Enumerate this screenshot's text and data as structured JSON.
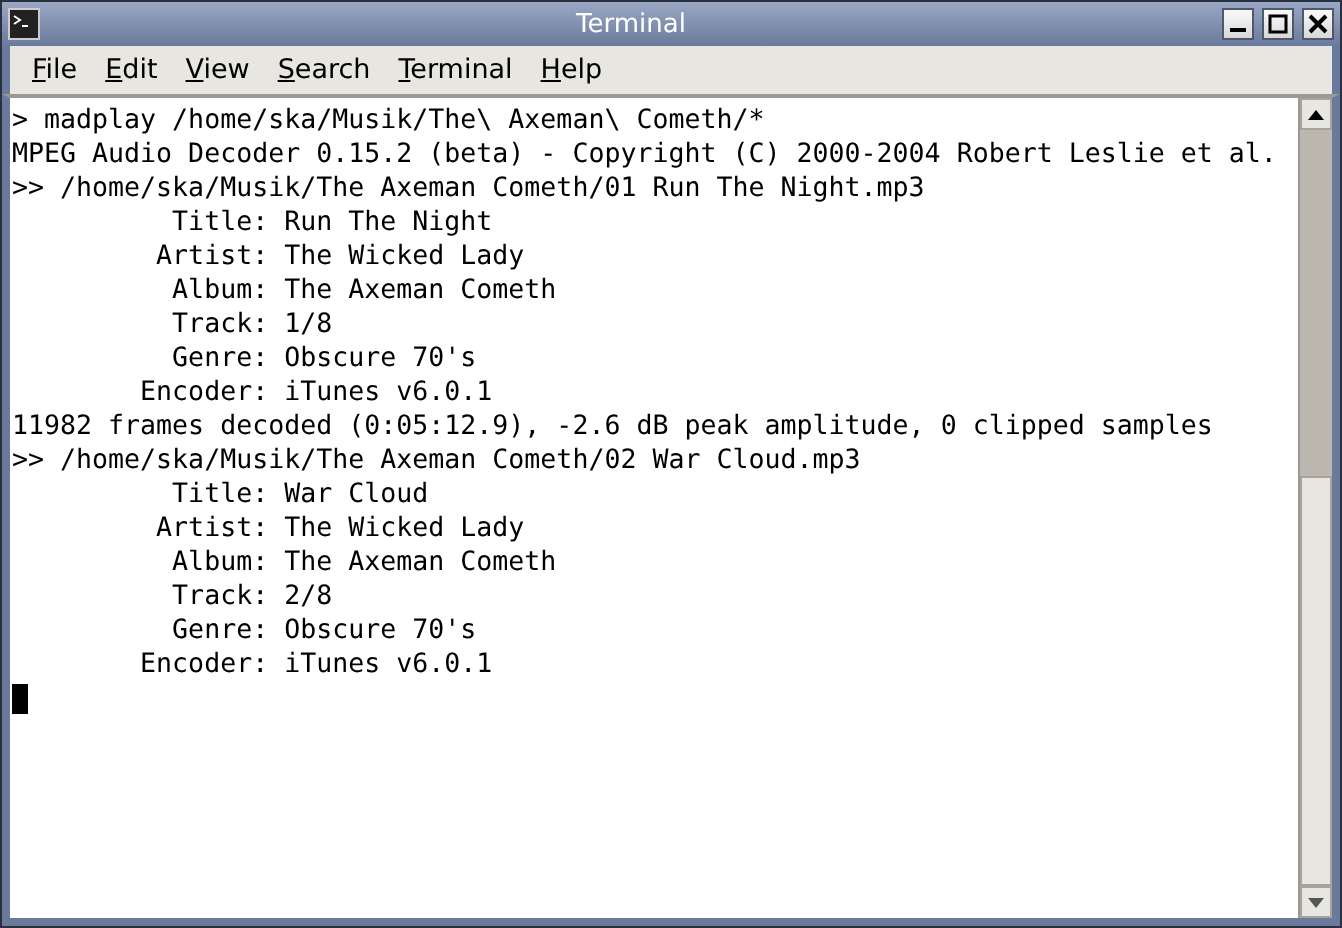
{
  "window": {
    "title": "Terminal"
  },
  "menu": [
    "File",
    "Edit",
    "View",
    "Search",
    "Terminal",
    "Help"
  ],
  "terminal": {
    "lines": [
      "> madplay /home/ska/Musik/The\\ Axeman\\ Cometh/*",
      "MPEG Audio Decoder 0.15.2 (beta) - Copyright (C) 2000-2004 Robert Leslie et al.",
      ">> /home/ska/Musik/The Axeman Cometh/01 Run The Night.mp3",
      "          Title: Run The Night",
      "         Artist: The Wicked Lady",
      "          Album: The Axeman Cometh",
      "          Track: 1/8",
      "          Genre: Obscure 70's",
      "        Encoder: iTunes v6.0.1",
      "11982 frames decoded (0:05:12.9), -2.6 dB peak amplitude, 0 clipped samples",
      ">> /home/ska/Musik/The Axeman Cometh/02 War Cloud.mp3",
      "          Title: War Cloud",
      "         Artist: The Wicked Lady",
      "          Album: The Axeman Cometh",
      "          Track: 2/8",
      "          Genre: Obscure 70's",
      "        Encoder: iTunes v6.0.1"
    ]
  }
}
